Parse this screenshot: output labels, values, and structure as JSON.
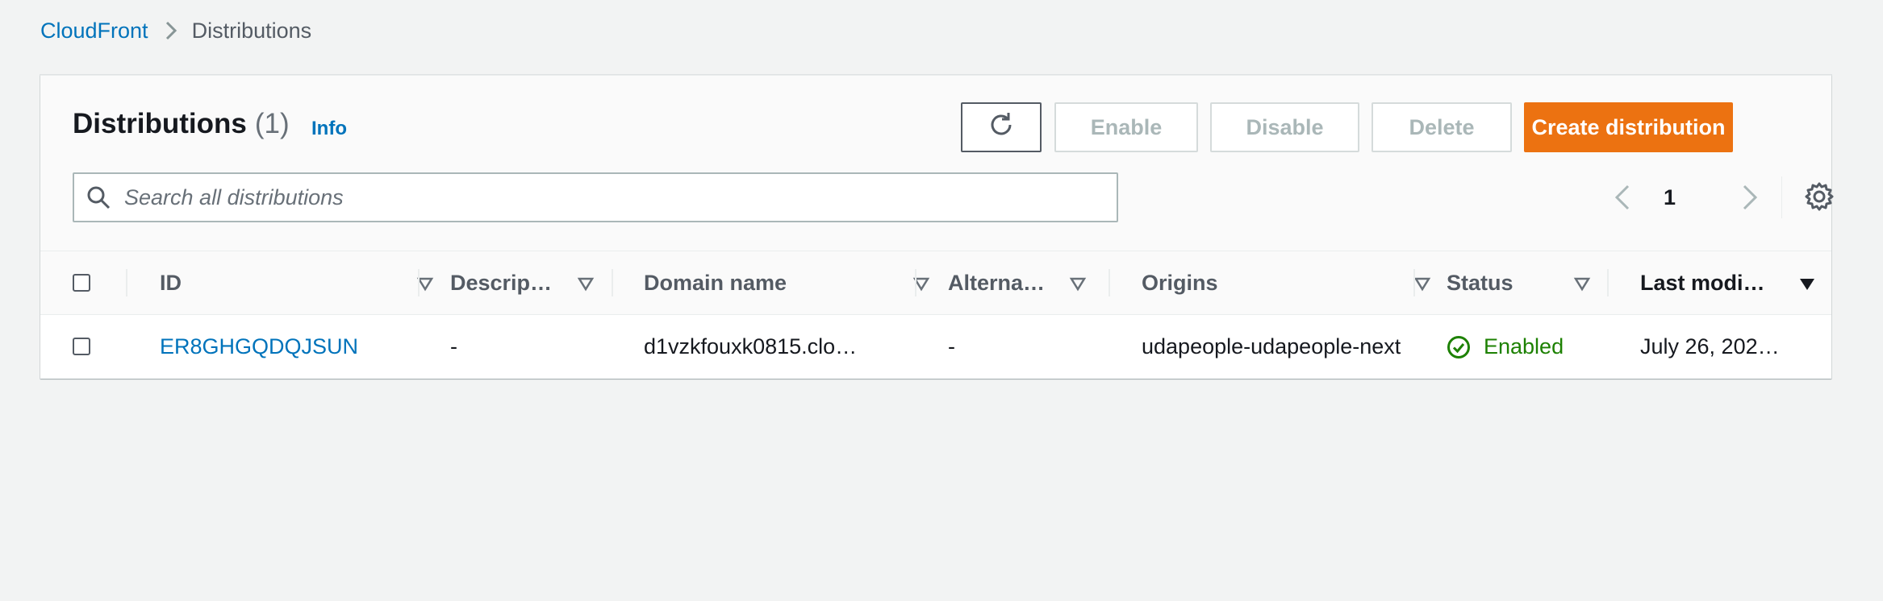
{
  "breadcrumb": {
    "parent": "CloudFront",
    "current": "Distributions"
  },
  "header": {
    "title": "Distributions",
    "count": "(1)",
    "info": "Info"
  },
  "actions": {
    "refresh_icon": "refresh-icon",
    "enable": "Enable",
    "disable": "Disable",
    "delete": "Delete",
    "create": "Create distribution"
  },
  "search": {
    "placeholder": "Search all distributions",
    "value": ""
  },
  "pagination": {
    "current_page": "1"
  },
  "table": {
    "columns": [
      {
        "label": "ID"
      },
      {
        "label": "Descrip…"
      },
      {
        "label": "Domain name"
      },
      {
        "label": "Alterna…"
      },
      {
        "label": "Origins"
      },
      {
        "label": "Status"
      },
      {
        "label": "Last modi…"
      }
    ],
    "rows": [
      {
        "id": "ER8GHGQDQJSUN",
        "description": "-",
        "domain_name": "d1vzkfouxk0815.clo…",
        "alternate": "-",
        "origins": "udapeople-udapeople-next",
        "status": "Enabled",
        "last_modified": "July 26, 202…"
      }
    ]
  },
  "colors": {
    "link": "#0073bb",
    "primary": "#ec7211",
    "success": "#1d8102",
    "background": "#f2f3f3"
  }
}
